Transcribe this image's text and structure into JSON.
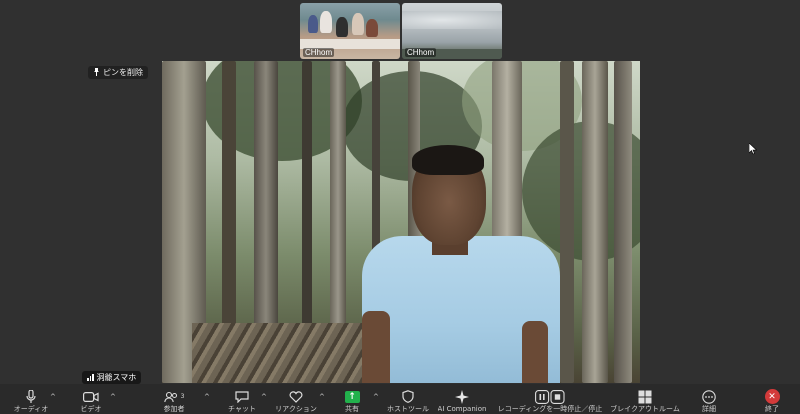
{
  "thumbnails": [
    {
      "name": "CHhom"
    },
    {
      "name": "CHhom"
    }
  ],
  "unpin": {
    "label": "ピンを削除",
    "icon": "pin-icon"
  },
  "main_video": {
    "participant_name": "洞爺スマホ",
    "signal_icon": "signal-bars-icon"
  },
  "toolbar": {
    "items": [
      {
        "label": "オーディオ",
        "icon": "microphone-icon"
      },
      {
        "label": "ビデオ",
        "icon": "video-camera-icon"
      },
      {
        "label": "参加者",
        "icon": "participants-icon",
        "count": "3"
      },
      {
        "label": "チャット",
        "icon": "chat-icon"
      },
      {
        "label": "リアクション",
        "icon": "heart-icon"
      },
      {
        "label": "共有",
        "icon": "share-arrow-icon"
      },
      {
        "label": "ホストツール",
        "icon": "shield-icon"
      },
      {
        "label": "AI Companion",
        "icon": "sparkle-icon"
      },
      {
        "label": "レコーディングを一時停止／停止",
        "icon": "pause-stop-icon"
      },
      {
        "label": "ブレイクアウトルーム",
        "icon": "grid-icon"
      },
      {
        "label": "詳細",
        "icon": "more-icon"
      },
      {
        "label": "終了",
        "icon": "close-icon"
      }
    ]
  },
  "colors": {
    "share": "#22b14c",
    "end": "#d33a3a",
    "toolbar_bg": "#2a2a2a"
  }
}
